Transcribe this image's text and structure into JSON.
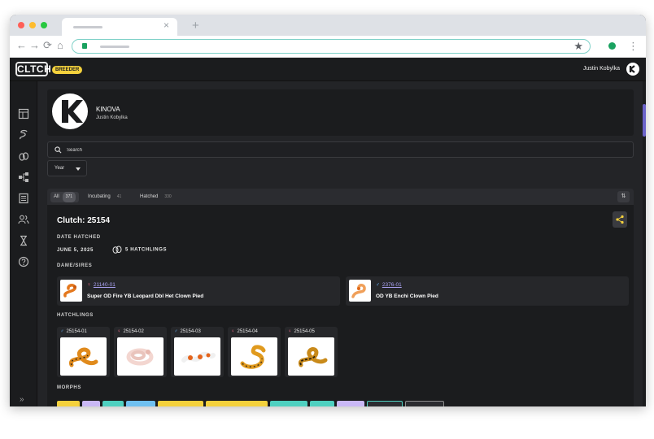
{
  "browser": {
    "tab_close": "×",
    "new_tab": "+",
    "back": "←",
    "forward": "→",
    "reload": "⟳",
    "home": "⌂",
    "star": "★",
    "menu": "⋮"
  },
  "app": {
    "logo": "CLTCH",
    "badge": "BREEDER",
    "user_name": "Justin Kobylka"
  },
  "sidebar": {
    "items": [
      "dashboard-icon",
      "snake-icon",
      "eggs-icon",
      "pairings-icon",
      "records-icon",
      "users-icon",
      "hourglass-icon",
      "help-icon"
    ],
    "expand": "»"
  },
  "profile": {
    "name": "KINOVA",
    "owner": "Justin Kobylka"
  },
  "search": {
    "placeholder": "Search"
  },
  "filters": {
    "year_label": "Year"
  },
  "tabs": [
    {
      "label": "All",
      "count": "371"
    },
    {
      "label": "Incubating",
      "count": "41"
    },
    {
      "label": "Hatched",
      "count": "330"
    }
  ],
  "sort_icon": "⇅",
  "clutch": {
    "title": "Clutch: 25154",
    "date_hatched_label": "DATE HATCHED",
    "date_hatched": "JUNE 5, 2025",
    "hatchlings_count": "5 HATCHLINGS",
    "dame_sires_label": "DAME/SIRES",
    "parents": [
      {
        "sex": "♀",
        "id": "21140-01",
        "morph": "Super OD Fire YB Leopard Dbl Het Clown Pied"
      },
      {
        "sex": "♂",
        "id": "2376-01",
        "morph": "OD YB Enchi Clown Pied"
      }
    ],
    "hatchlings_label": "HATCHLINGS",
    "hatchlings": [
      {
        "sex": "♂",
        "id": "25154-01"
      },
      {
        "sex": "♀",
        "id": "25154-02"
      },
      {
        "sex": "♂",
        "id": "25154-03"
      },
      {
        "sex": "♀",
        "id": "25154-04"
      },
      {
        "sex": "♀",
        "id": "25154-05"
      }
    ],
    "morphs_label": "MORPHS",
    "morph_chip_colors": [
      "#f4d13d",
      "#c9b8f5",
      "#4fd0c0",
      "#6fc0f0",
      "#f4d13d",
      "#f4d13d",
      "#4fd0c0",
      "#4fd0c0",
      "#c9b8f5",
      "#2b2c30",
      "#2b2c30"
    ]
  },
  "colors": {
    "accent": "#f4d13d",
    "link": "#a9a1f2",
    "female": "#ff6f8c",
    "male": "#6cb6ff",
    "background": "#232427",
    "panel": "#1b1c1e"
  }
}
